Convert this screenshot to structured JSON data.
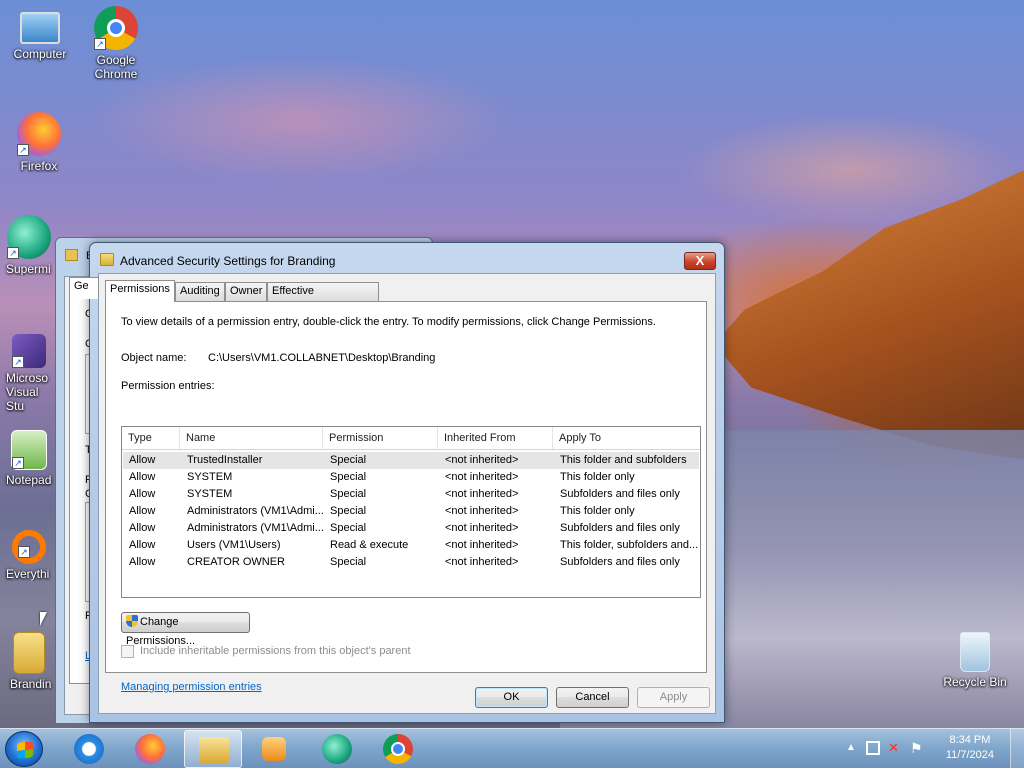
{
  "desktop": {
    "icons": [
      {
        "label": "Computer",
        "icon": "computer-icon"
      },
      {
        "label": "Google Chrome",
        "icon": "chrome-icon"
      },
      {
        "label": "Firefox",
        "icon": "firefox-icon"
      },
      {
        "label": "Supermi",
        "icon": "supermium-icon"
      },
      {
        "label": "Microso Visual Stu",
        "icon": "visual-studio-icon"
      },
      {
        "label": "Notepad",
        "icon": "notepad-icon"
      },
      {
        "label": "Everythi",
        "icon": "everything-icon"
      },
      {
        "label": "Brandin",
        "icon": "folder-icon"
      },
      {
        "label": "Recycle Bin",
        "icon": "recycle-bin-icon"
      }
    ]
  },
  "background_window": {
    "title_initial": "B",
    "tab_initial": "Ge",
    "side_letters": [
      "O",
      "G",
      "T",
      "P",
      "C",
      "F"
    ],
    "link_initial": "L"
  },
  "dialog": {
    "title": "Advanced Security Settings for Branding",
    "close_label": "X",
    "tabs": [
      "Permissions",
      "Auditing",
      "Owner",
      "Effective Permissions"
    ],
    "instructions": "To view details of a permission entry, double-click the entry. To modify permissions, click Change Permissions.",
    "object_name_label": "Object name:",
    "object_name_value": "C:\\Users\\VM1.COLLABNET\\Desktop\\Branding",
    "entries_label": "Permission entries:",
    "columns": [
      "Type",
      "Name",
      "Permission",
      "Inherited From",
      "Apply To"
    ],
    "rows": [
      [
        "Allow",
        "TrustedInstaller",
        "Special",
        "<not inherited>",
        "This folder and subfolders"
      ],
      [
        "Allow",
        "SYSTEM",
        "Special",
        "<not inherited>",
        "This folder only"
      ],
      [
        "Allow",
        "SYSTEM",
        "Special",
        "<not inherited>",
        "Subfolders and files only"
      ],
      [
        "Allow",
        "Administrators (VM1\\Admi...",
        "Special",
        "<not inherited>",
        "This folder only"
      ],
      [
        "Allow",
        "Administrators (VM1\\Admi...",
        "Special",
        "<not inherited>",
        "Subfolders and files only"
      ],
      [
        "Allow",
        "Users (VM1\\Users)",
        "Read & execute",
        "<not inherited>",
        "This folder, subfolders and..."
      ],
      [
        "Allow",
        "CREATOR OWNER",
        "Special",
        "<not inherited>",
        "Subfolders and files only"
      ]
    ],
    "change_permissions": "Change Permissions...",
    "include_inheritable": "Include inheritable permissions from this object's parent",
    "managing_link": "Managing permission entries",
    "ok": "OK",
    "cancel": "Cancel",
    "apply": "Apply"
  },
  "taskbar": {
    "apps": [
      "internet-explorer-icon",
      "firefox-icon",
      "file-explorer-icon",
      "media-player-icon",
      "supermium-icon",
      "chrome-icon"
    ],
    "time": "8:34 PM",
    "date": "11/7/2024"
  }
}
